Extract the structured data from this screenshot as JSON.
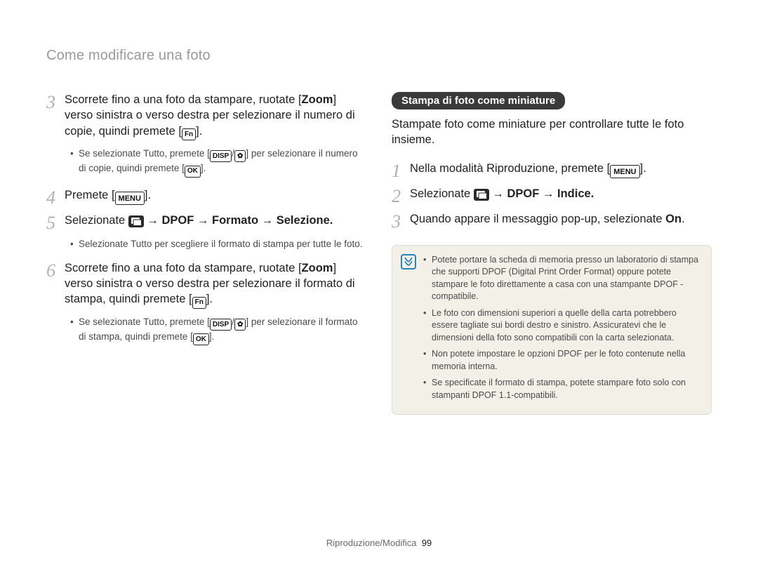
{
  "header": {
    "title": "Come modificare una foto"
  },
  "btn": {
    "zoom": "Zoom",
    "fn": "Fn",
    "disp": "DISP",
    "ok": "OK",
    "menu": "MENU",
    "tutto": "Tutto",
    "on": "On"
  },
  "arrow": "→",
  "left": {
    "step3": {
      "num": "3",
      "body": [
        "Scorrete fino a una foto da stampare, ruotate [",
        "] verso sinistra o verso destra per selezionare il numero di copie, quindi premete [",
        "]."
      ],
      "bullets": [
        "Se selezionate ",
        ", premete [",
        "/",
        "] per selezionare il numero di copie, quindi premete [",
        "]."
      ]
    },
    "step4": {
      "num": "4",
      "body": [
        "Premete [",
        "]."
      ]
    },
    "step5": {
      "num": "5",
      "body": [
        "Selezionate ",
        " ",
        " DPOF ",
        " Formato ",
        " Selezione."
      ],
      "bullets": [
        "Selezionate ",
        " per scegliere il formato di stampa per tutte le foto."
      ]
    },
    "step6": {
      "num": "6",
      "body": [
        "Scorrete fino a una foto da stampare, ruotate [",
        "] verso sinistra o verso destra per selezionare il formato di stampa, quindi premete [",
        "]."
      ],
      "bullets": [
        "Se selezionate ",
        ", premete [",
        "/",
        "] per selezionare il formato di stampa, quindi premete [",
        "]."
      ]
    }
  },
  "right": {
    "pill": "Stampa di foto come miniature",
    "intro": "Stampate foto come miniature per controllare tutte le foto insieme.",
    "step1": {
      "num": "1",
      "body": [
        "Nella modalità Riproduzione, premete [",
        "]."
      ]
    },
    "step2": {
      "num": "2",
      "body": [
        "Selezionate ",
        " ",
        " DPOF ",
        " Indice."
      ]
    },
    "step3": {
      "num": "3",
      "body": [
        "Quando appare il messaggio pop-up, selezionate ",
        "."
      ]
    },
    "note": {
      "bullets": [
        "Potete portare la scheda di memoria presso un laboratorio di stampa che supporti DPOF (Digital Print Order Format) oppure potete stampare le foto direttamente a casa con una stampante DPOF -compatibile.",
        "Le foto con dimensioni superiori a quelle della carta potrebbero essere tagliate sui bordi destro e sinistro. Assicuratevi che le dimensioni della foto sono compatibili con la carta selezionata.",
        "Non potete impostare le opzioni DPOF per le foto contenute nella memoria interna.",
        "Se specificate il formato di stampa, potete stampare foto solo con stampanti DPOF 1.1-compatibili."
      ]
    }
  },
  "footer": {
    "section": "Riproduzione/Modifica",
    "page": "99"
  }
}
